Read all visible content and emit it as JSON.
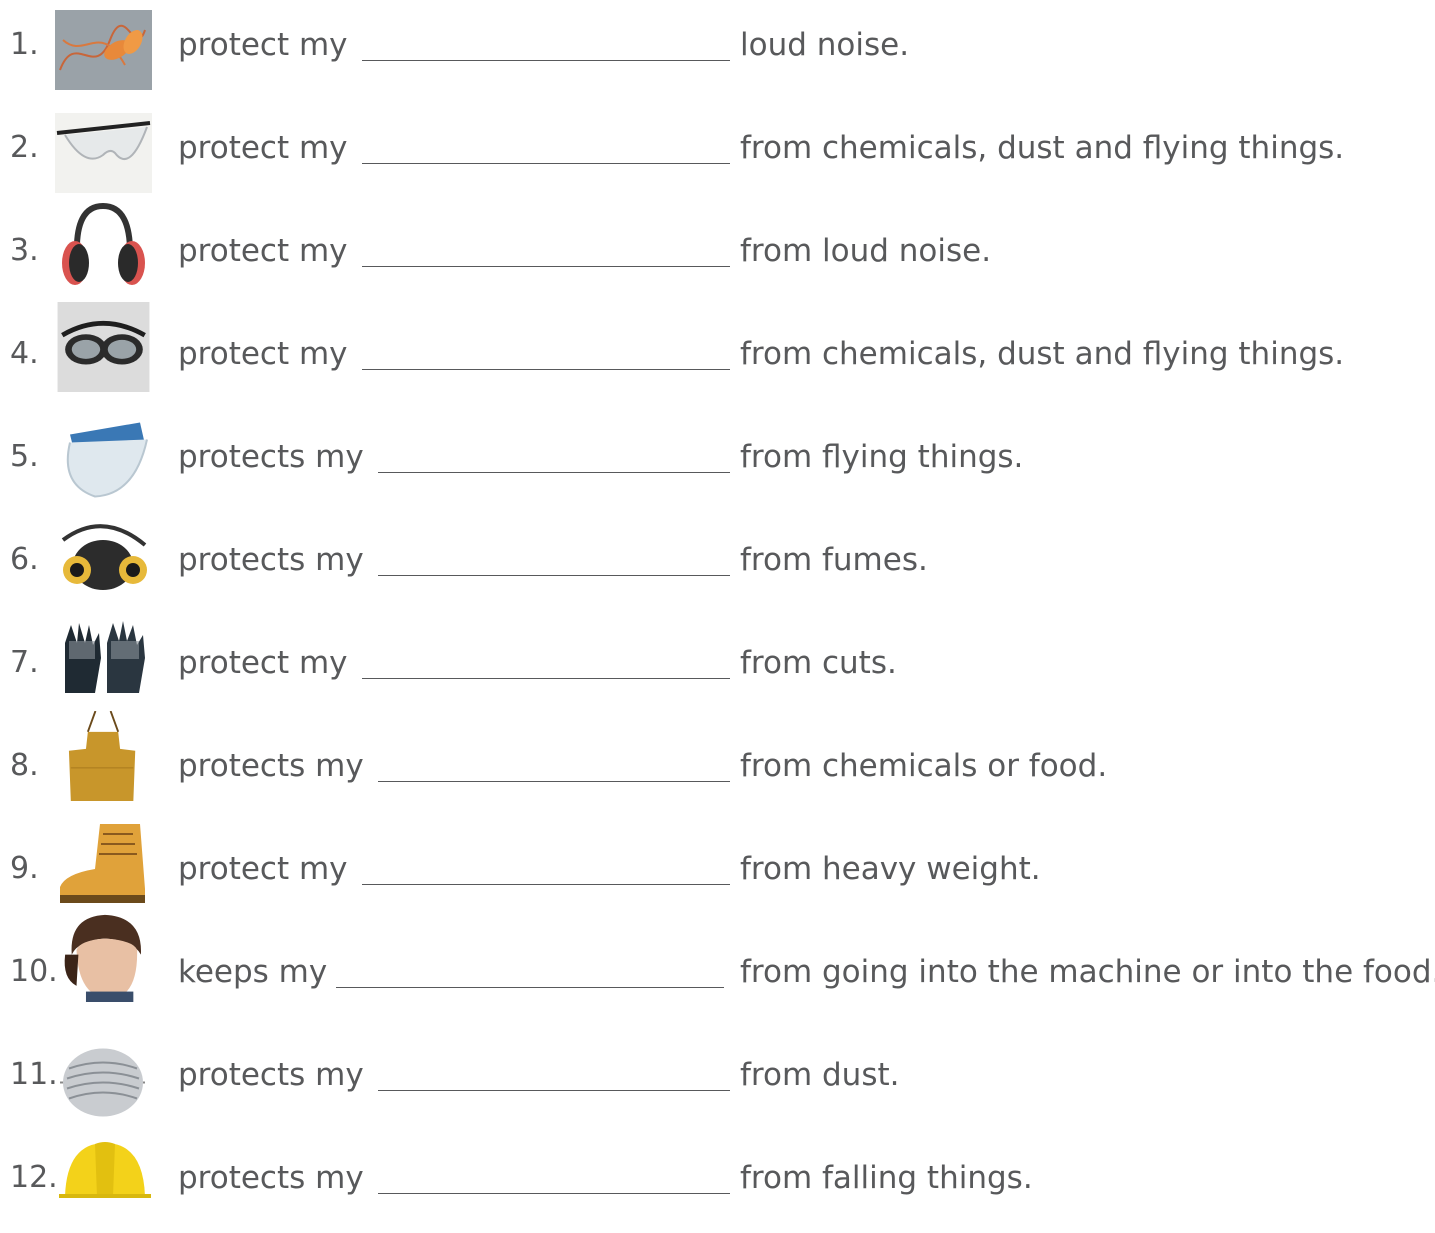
{
  "items": [
    {
      "number": "1.",
      "lead": "protect my",
      "tail": "loud noise.",
      "icon": "earplugs-icon"
    },
    {
      "number": "2.",
      "lead": "protect my",
      "tail": "from chemicals, dust and flying things.",
      "icon": "safety-glasses-icon"
    },
    {
      "number": "3.",
      "lead": "protect my",
      "tail": "from loud noise.",
      "icon": "ear-muffs-icon"
    },
    {
      "number": "4.",
      "lead": "protect my",
      "tail": "from chemicals, dust and flying things.",
      "icon": "goggles-icon"
    },
    {
      "number": "5.",
      "lead": "protects my",
      "tail": "from flying things.",
      "icon": "face-shield-icon"
    },
    {
      "number": "6.",
      "lead": "protects my",
      "tail": "from fumes.",
      "icon": "respirator-icon"
    },
    {
      "number": "7.",
      "lead": "protect my",
      "tail": "from cuts.",
      "icon": "gloves-icon"
    },
    {
      "number": "8.",
      "lead": "protects my",
      "tail": "from chemicals or food.",
      "icon": "apron-icon"
    },
    {
      "number": "9.",
      "lead": "protect my",
      "tail": "from heavy weight.",
      "icon": "safety-boot-icon"
    },
    {
      "number": "10.",
      "lead": "keeps my",
      "tail": "from going into the machine or into the food.",
      "icon": "hairnet-icon"
    },
    {
      "number": "11.",
      "lead": "protects my",
      "tail": "from dust.",
      "icon": "dust-mask-icon"
    },
    {
      "number": "12.",
      "lead": "protects my",
      "tail": "from falling things.",
      "icon": "hard-hat-icon"
    }
  ]
}
